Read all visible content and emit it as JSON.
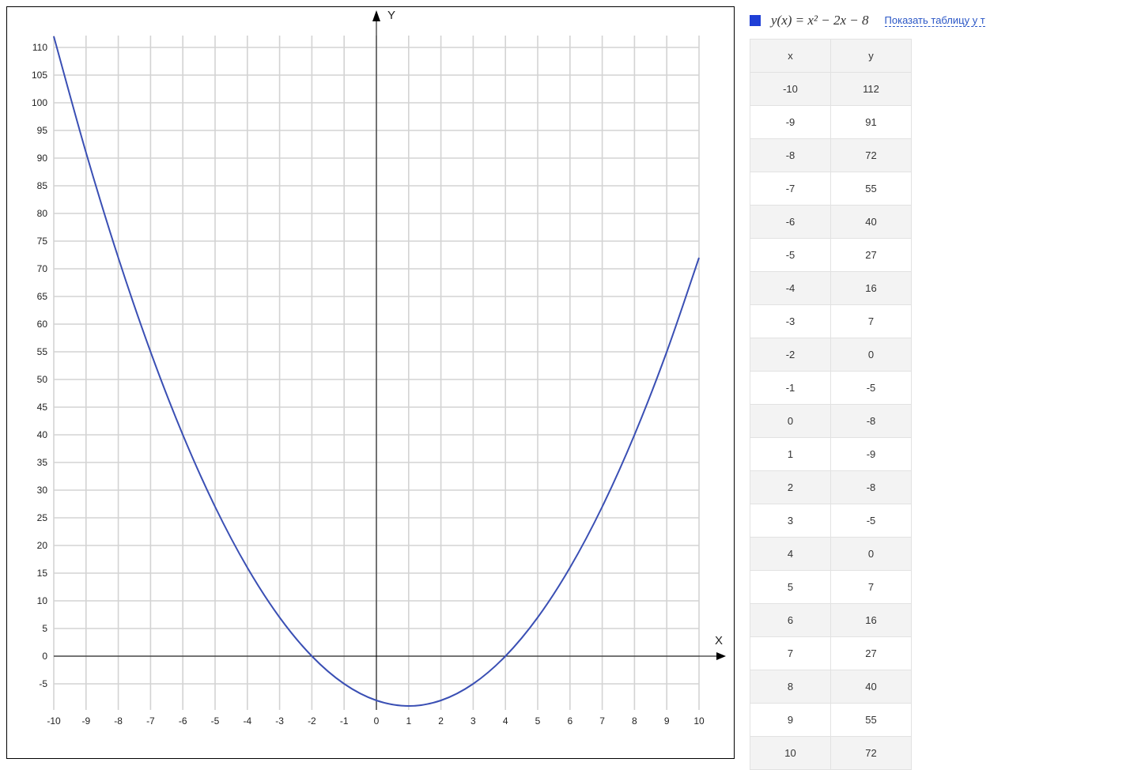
{
  "legend": {
    "color": "#1f3fd6",
    "formula": "y(x) = x² − 2x − 8",
    "link_text": "Показать таблицу у т"
  },
  "table": {
    "headers": [
      "x",
      "y"
    ],
    "rows": [
      [
        "-10",
        "112"
      ],
      [
        "-9",
        "91"
      ],
      [
        "-8",
        "72"
      ],
      [
        "-7",
        "55"
      ],
      [
        "-6",
        "40"
      ],
      [
        "-5",
        "27"
      ],
      [
        "-4",
        "16"
      ],
      [
        "-3",
        "7"
      ],
      [
        "-2",
        "0"
      ],
      [
        "-1",
        "-5"
      ],
      [
        "0",
        "-8"
      ],
      [
        "1",
        "-9"
      ],
      [
        "2",
        "-8"
      ],
      [
        "3",
        "-5"
      ],
      [
        "4",
        "0"
      ],
      [
        "5",
        "7"
      ],
      [
        "6",
        "16"
      ],
      [
        "7",
        "27"
      ],
      [
        "8",
        "40"
      ],
      [
        "9",
        "55"
      ],
      [
        "10",
        "72"
      ]
    ]
  },
  "chart_data": {
    "type": "line",
    "title": "",
    "xlabel": "X",
    "ylabel": "Y",
    "xlim": [
      -10,
      10
    ],
    "ylim": [
      -10,
      112
    ],
    "grid": true,
    "line_color": "#3a4fb4",
    "x_ticks": [
      -10,
      -9,
      -8,
      -7,
      -6,
      -5,
      -4,
      -3,
      -2,
      -1,
      0,
      1,
      2,
      3,
      4,
      5,
      6,
      7,
      8,
      9,
      10
    ],
    "y_ticks": [
      -5,
      0,
      5,
      10,
      15,
      20,
      25,
      30,
      35,
      40,
      45,
      50,
      55,
      60,
      65,
      70,
      75,
      80,
      85,
      90,
      95,
      100,
      105,
      110
    ],
    "series": [
      {
        "x": [
          -10,
          -9,
          -8,
          -7,
          -6,
          -5,
          -4,
          -3,
          -2,
          -1,
          0,
          1,
          2,
          3,
          4,
          5,
          6,
          7,
          8,
          9,
          10
        ],
        "values": [
          112,
          91,
          72,
          55,
          40,
          27,
          16,
          7,
          0,
          -5,
          -8,
          -9,
          -8,
          -5,
          0,
          7,
          16,
          27,
          40,
          55,
          72
        ]
      }
    ]
  }
}
